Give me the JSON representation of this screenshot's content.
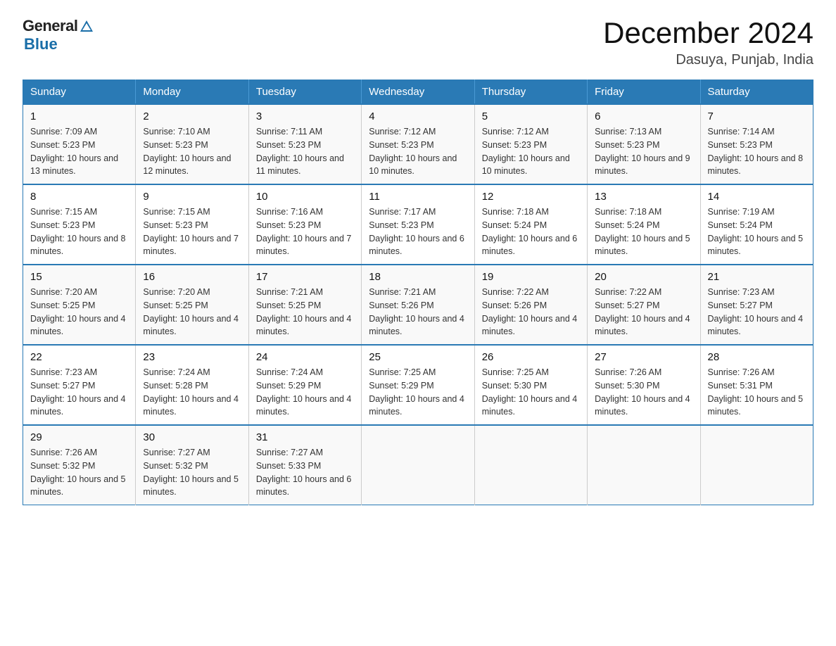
{
  "header": {
    "title": "December 2024",
    "location": "Dasuya, Punjab, India",
    "logo_general": "General",
    "logo_blue": "Blue"
  },
  "calendar": {
    "days_of_week": [
      "Sunday",
      "Monday",
      "Tuesday",
      "Wednesday",
      "Thursday",
      "Friday",
      "Saturday"
    ],
    "weeks": [
      [
        {
          "day": "1",
          "sunrise": "7:09 AM",
          "sunset": "5:23 PM",
          "daylight": "10 hours and 13 minutes."
        },
        {
          "day": "2",
          "sunrise": "7:10 AM",
          "sunset": "5:23 PM",
          "daylight": "10 hours and 12 minutes."
        },
        {
          "day": "3",
          "sunrise": "7:11 AM",
          "sunset": "5:23 PM",
          "daylight": "10 hours and 11 minutes."
        },
        {
          "day": "4",
          "sunrise": "7:12 AM",
          "sunset": "5:23 PM",
          "daylight": "10 hours and 10 minutes."
        },
        {
          "day": "5",
          "sunrise": "7:12 AM",
          "sunset": "5:23 PM",
          "daylight": "10 hours and 10 minutes."
        },
        {
          "day": "6",
          "sunrise": "7:13 AM",
          "sunset": "5:23 PM",
          "daylight": "10 hours and 9 minutes."
        },
        {
          "day": "7",
          "sunrise": "7:14 AM",
          "sunset": "5:23 PM",
          "daylight": "10 hours and 8 minutes."
        }
      ],
      [
        {
          "day": "8",
          "sunrise": "7:15 AM",
          "sunset": "5:23 PM",
          "daylight": "10 hours and 8 minutes."
        },
        {
          "day": "9",
          "sunrise": "7:15 AM",
          "sunset": "5:23 PM",
          "daylight": "10 hours and 7 minutes."
        },
        {
          "day": "10",
          "sunrise": "7:16 AM",
          "sunset": "5:23 PM",
          "daylight": "10 hours and 7 minutes."
        },
        {
          "day": "11",
          "sunrise": "7:17 AM",
          "sunset": "5:23 PM",
          "daylight": "10 hours and 6 minutes."
        },
        {
          "day": "12",
          "sunrise": "7:18 AM",
          "sunset": "5:24 PM",
          "daylight": "10 hours and 6 minutes."
        },
        {
          "day": "13",
          "sunrise": "7:18 AM",
          "sunset": "5:24 PM",
          "daylight": "10 hours and 5 minutes."
        },
        {
          "day": "14",
          "sunrise": "7:19 AM",
          "sunset": "5:24 PM",
          "daylight": "10 hours and 5 minutes."
        }
      ],
      [
        {
          "day": "15",
          "sunrise": "7:20 AM",
          "sunset": "5:25 PM",
          "daylight": "10 hours and 4 minutes."
        },
        {
          "day": "16",
          "sunrise": "7:20 AM",
          "sunset": "5:25 PM",
          "daylight": "10 hours and 4 minutes."
        },
        {
          "day": "17",
          "sunrise": "7:21 AM",
          "sunset": "5:25 PM",
          "daylight": "10 hours and 4 minutes."
        },
        {
          "day": "18",
          "sunrise": "7:21 AM",
          "sunset": "5:26 PM",
          "daylight": "10 hours and 4 minutes."
        },
        {
          "day": "19",
          "sunrise": "7:22 AM",
          "sunset": "5:26 PM",
          "daylight": "10 hours and 4 minutes."
        },
        {
          "day": "20",
          "sunrise": "7:22 AM",
          "sunset": "5:27 PM",
          "daylight": "10 hours and 4 minutes."
        },
        {
          "day": "21",
          "sunrise": "7:23 AM",
          "sunset": "5:27 PM",
          "daylight": "10 hours and 4 minutes."
        }
      ],
      [
        {
          "day": "22",
          "sunrise": "7:23 AM",
          "sunset": "5:27 PM",
          "daylight": "10 hours and 4 minutes."
        },
        {
          "day": "23",
          "sunrise": "7:24 AM",
          "sunset": "5:28 PM",
          "daylight": "10 hours and 4 minutes."
        },
        {
          "day": "24",
          "sunrise": "7:24 AM",
          "sunset": "5:29 PM",
          "daylight": "10 hours and 4 minutes."
        },
        {
          "day": "25",
          "sunrise": "7:25 AM",
          "sunset": "5:29 PM",
          "daylight": "10 hours and 4 minutes."
        },
        {
          "day": "26",
          "sunrise": "7:25 AM",
          "sunset": "5:30 PM",
          "daylight": "10 hours and 4 minutes."
        },
        {
          "day": "27",
          "sunrise": "7:26 AM",
          "sunset": "5:30 PM",
          "daylight": "10 hours and 4 minutes."
        },
        {
          "day": "28",
          "sunrise": "7:26 AM",
          "sunset": "5:31 PM",
          "daylight": "10 hours and 5 minutes."
        }
      ],
      [
        {
          "day": "29",
          "sunrise": "7:26 AM",
          "sunset": "5:32 PM",
          "daylight": "10 hours and 5 minutes."
        },
        {
          "day": "30",
          "sunrise": "7:27 AM",
          "sunset": "5:32 PM",
          "daylight": "10 hours and 5 minutes."
        },
        {
          "day": "31",
          "sunrise": "7:27 AM",
          "sunset": "5:33 PM",
          "daylight": "10 hours and 6 minutes."
        },
        null,
        null,
        null,
        null
      ]
    ]
  }
}
